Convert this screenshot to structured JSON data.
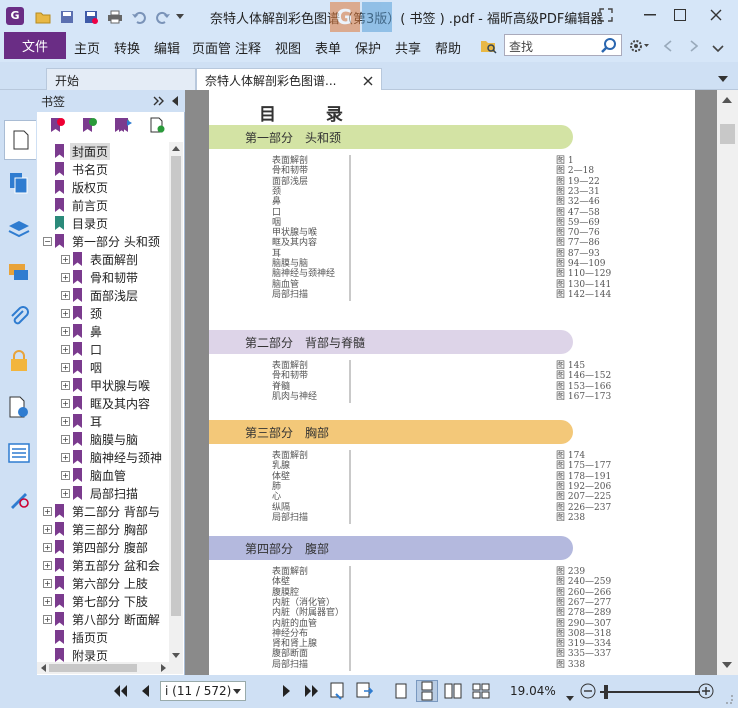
{
  "window": {
    "title": "奈特人体解剖彩色图谱（第3版）( 书签 ) .pdf - 福昕高级PDF编辑器",
    "watermark_letters": "G I"
  },
  "menu": {
    "file": "文件",
    "items": [
      "主页",
      "转换",
      "编辑",
      "页面管",
      "注释",
      "视图",
      "表单",
      "保护",
      "共享",
      "帮助"
    ],
    "search_placeholder": "查找"
  },
  "tabs": [
    {
      "label": "开始"
    },
    {
      "label": "奈特人体解剖彩色图谱...",
      "active": true
    }
  ],
  "bookmarks_panel": {
    "title": "书签",
    "nodes": [
      {
        "label": "封面页",
        "level": 0,
        "expand": "",
        "selected": true
      },
      {
        "label": "书名页",
        "level": 0,
        "expand": ""
      },
      {
        "label": "版权页",
        "level": 0,
        "expand": ""
      },
      {
        "label": "前言页",
        "level": 0,
        "expand": ""
      },
      {
        "label": "目录页",
        "level": 0,
        "expand": "",
        "teal": true
      },
      {
        "label": "第一部分 头和颈",
        "level": 0,
        "expand": "−"
      },
      {
        "label": "表面解剖",
        "level": 1,
        "expand": "+"
      },
      {
        "label": "骨和韧带",
        "level": 1,
        "expand": "+"
      },
      {
        "label": "面部浅层",
        "level": 1,
        "expand": "+"
      },
      {
        "label": "颈",
        "level": 1,
        "expand": "+"
      },
      {
        "label": "鼻",
        "level": 1,
        "expand": "+"
      },
      {
        "label": "口",
        "level": 1,
        "expand": "+"
      },
      {
        "label": "咽",
        "level": 1,
        "expand": "+"
      },
      {
        "label": "甲状腺与喉",
        "level": 1,
        "expand": "+"
      },
      {
        "label": "眶及其内容",
        "level": 1,
        "expand": "+"
      },
      {
        "label": "耳",
        "level": 1,
        "expand": "+"
      },
      {
        "label": "脑膜与脑",
        "level": 1,
        "expand": "+"
      },
      {
        "label": "脑神经与颈神",
        "level": 1,
        "expand": "+"
      },
      {
        "label": "脑血管",
        "level": 1,
        "expand": "+"
      },
      {
        "label": "局部扫描",
        "level": 1,
        "expand": "+"
      },
      {
        "label": "第二部分 背部与",
        "level": 0,
        "expand": "+"
      },
      {
        "label": "第三部分 胸部",
        "level": 0,
        "expand": "+"
      },
      {
        "label": "第四部分 腹部",
        "level": 0,
        "expand": "+"
      },
      {
        "label": "第五部分 盆和会",
        "level": 0,
        "expand": "+"
      },
      {
        "label": "第六部分 上肢",
        "level": 0,
        "expand": "+"
      },
      {
        "label": "第七部分 下肢",
        "level": 0,
        "expand": "+"
      },
      {
        "label": "第八部分 断面解",
        "level": 0,
        "expand": "+"
      },
      {
        "label": "插页页",
        "level": 0,
        "expand": ""
      },
      {
        "label": "附录页",
        "level": 0,
        "expand": ""
      }
    ]
  },
  "document": {
    "heading": "目 录",
    "sections": [
      {
        "title": "第一部分　头和颈",
        "color": "#d3e3a4",
        "entries": [
          [
            "表面解剖",
            "图 1"
          ],
          [
            "骨和韧带",
            "图 2—18"
          ],
          [
            "面部浅层",
            "图 19—22"
          ],
          [
            "颈",
            "图 23—31"
          ],
          [
            "鼻",
            "图 32—46"
          ],
          [
            "口",
            "图 47—58"
          ],
          [
            "咽",
            "图 59—69"
          ],
          [
            "甲状腺与喉",
            "图 70—76"
          ],
          [
            "眶及其内容",
            "图 77—86"
          ],
          [
            "耳",
            "图 87—93"
          ],
          [
            "脑膜与脑",
            "图 94—109"
          ],
          [
            "脑神经与颈神经",
            "图 110—129"
          ],
          [
            "脑血管",
            "图 130—141"
          ],
          [
            "局部扫描",
            "图 142—144"
          ]
        ]
      },
      {
        "title": "第二部分　背部与脊髓",
        "color": "#ddd4e8",
        "entries": [
          [
            "表面解剖",
            "图 145"
          ],
          [
            "骨和韧带",
            "图 146—152"
          ],
          [
            "脊髓",
            "图 153—166"
          ],
          [
            "肌肉与神经",
            "图 167—173"
          ]
        ]
      },
      {
        "title": "第三部分　胸部",
        "color": "#f3c879",
        "entries": [
          [
            "表面解剖",
            "图 174"
          ],
          [
            "乳腺",
            "图 175—177"
          ],
          [
            "体壁",
            "图 178—191"
          ],
          [
            "肺",
            "图 192—206"
          ],
          [
            "心",
            "图 207—225"
          ],
          [
            "纵隔",
            "图 226—237"
          ],
          [
            "局部扫描",
            "图 238"
          ]
        ]
      },
      {
        "title": "第四部分　腹部",
        "color": "#b4b9de",
        "entries": [
          [
            "表面解剖",
            "图 239"
          ],
          [
            "体壁",
            "图 240—259"
          ],
          [
            "腹膜腔",
            "图 260—266"
          ],
          [
            "内脏（消化管）",
            "图 267—277"
          ],
          [
            "内脏（附属器官）",
            "图 278—289"
          ],
          [
            "内脏的血管",
            "图 290—307"
          ],
          [
            "神经分布",
            "图 308—318"
          ],
          [
            "肾和肾上腺",
            "图 319—334"
          ],
          [
            "腹部断面",
            "图 335—337"
          ],
          [
            "局部扫描",
            "图 338"
          ]
        ]
      }
    ]
  },
  "status": {
    "page_display": "i (11 / 572)",
    "zoom": "19.04%"
  },
  "colors": {
    "accent": "#6a2d85",
    "bookmark": "#7b3b8e",
    "bookmark_toc": "#2b8a7a"
  }
}
